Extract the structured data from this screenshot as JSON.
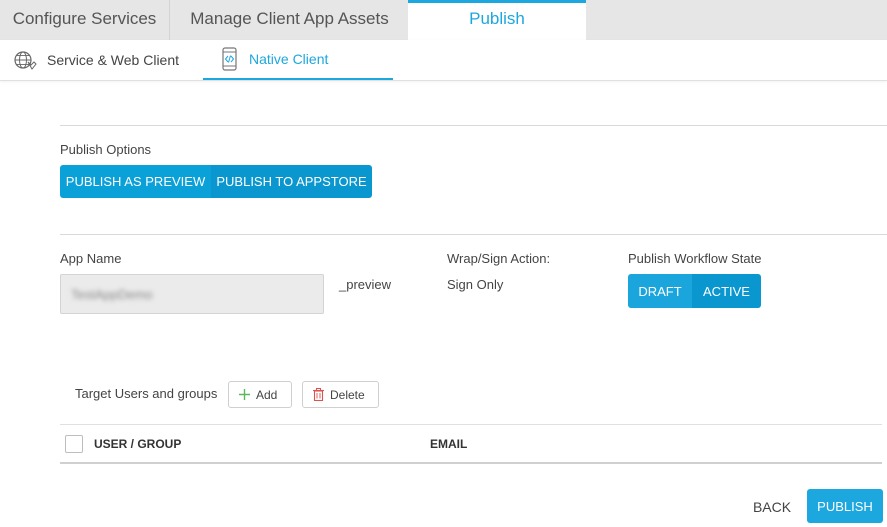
{
  "top_tabs": [
    {
      "label": "Configure Services"
    },
    {
      "label": "Manage Client App Assets"
    },
    {
      "label": "Publish"
    }
  ],
  "sub_tabs": [
    {
      "label": "Service & Web Client",
      "icon": "globe-icon"
    },
    {
      "label": "Native Client",
      "icon": "mobile-code-icon"
    }
  ],
  "publish_options": {
    "label": "Publish Options",
    "buttons": [
      "PUBLISH AS PREVIEW",
      "PUBLISH TO APPSTORE"
    ],
    "selected": "PUBLISH AS PREVIEW"
  },
  "app": {
    "name_label": "App Name",
    "name_value": "TestAppDemo",
    "suffix": "_preview",
    "wrap_label": "Wrap/Sign Action:",
    "wrap_value": "Sign Only",
    "workflow_label": "Publish Workflow State",
    "workflow_buttons": [
      "DRAFT",
      "ACTIVE"
    ],
    "workflow_selected": "ACTIVE"
  },
  "targets": {
    "label": "Target Users and groups",
    "add_label": "Add",
    "delete_label": "Delete"
  },
  "table": {
    "columns": [
      "USER / GROUP",
      "EMAIL"
    ]
  },
  "footer": {
    "back_label": "BACK",
    "publish_label": "PUBLISH"
  },
  "colors": {
    "accent": "#1da7df",
    "delete_icon": "#d9534f",
    "add_icon": "#5cb85c"
  }
}
